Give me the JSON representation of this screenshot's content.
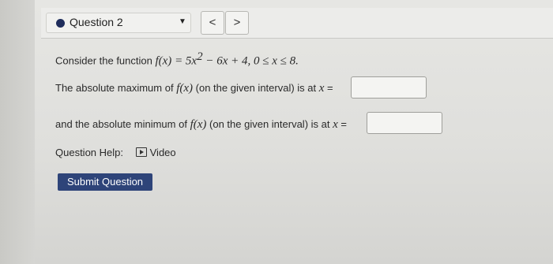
{
  "toolbar": {
    "question_label": "Question 2",
    "prev_label": "<",
    "next_label": ">"
  },
  "problem": {
    "intro": "Consider the function",
    "function_lhs": "f(x)",
    "function_rhs_prefix": " = 5x",
    "function_exponent": "2",
    "function_rhs_suffix": " − 6x + 4,  0 ≤ x ≤ 8.",
    "max_prefix": "The absolute maximum of",
    "max_fx": "f(x)",
    "max_suffix": "(on the given interval) is at",
    "max_var": "x",
    "max_eq": "=",
    "min_prefix": "and the absolute minimum of",
    "min_fx": "f(x)",
    "min_suffix": "(on the given interval) is at",
    "min_var": "x",
    "min_eq": "=",
    "max_answer": "",
    "min_answer": ""
  },
  "help": {
    "label": "Question Help:",
    "video_label": "Video"
  },
  "actions": {
    "submit_label": "Submit Question"
  },
  "icons": {
    "question_status": "filled-dot-icon",
    "dropdown": "caret-down-icon",
    "video": "video-play-icon",
    "cursor": "mouse-pointer-icon"
  },
  "colors": {
    "submit_bg": "#2e4479",
    "status_dot": "#1f2d5c"
  }
}
